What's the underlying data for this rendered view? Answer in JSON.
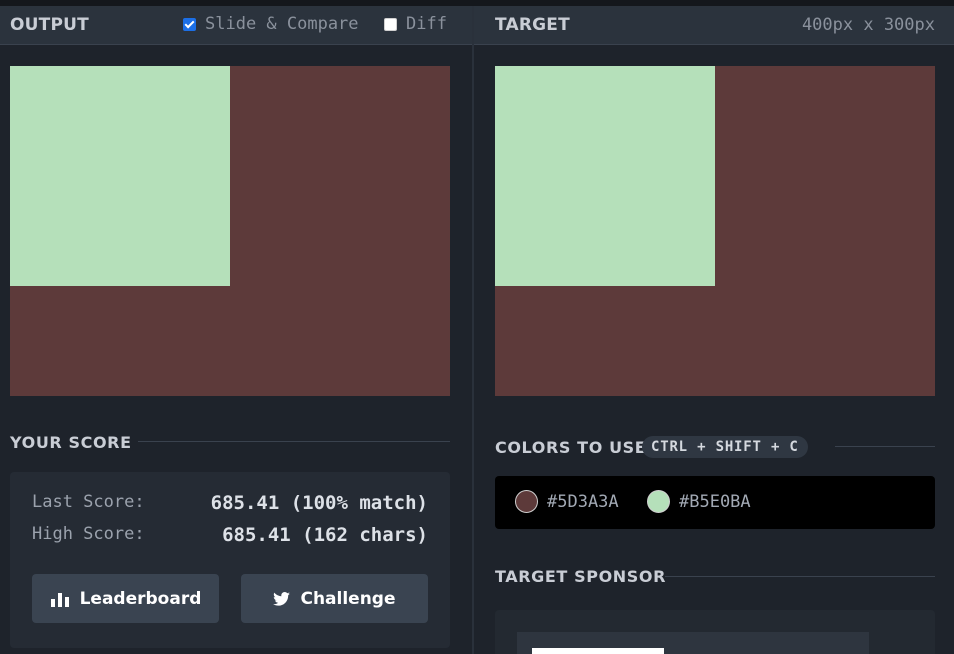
{
  "output_panel": {
    "title": "OUTPUT",
    "slide_compare": {
      "label": "Slide & Compare",
      "checked": true
    },
    "diff": {
      "label": "Diff",
      "checked": false
    }
  },
  "target_panel": {
    "title": "TARGET",
    "dimensions": "400px x 300px"
  },
  "canvas": {
    "background": "#5D3A3A",
    "square_color": "#B5E0BA"
  },
  "score": {
    "title": "YOUR SCORE",
    "last_label": "Last Score:",
    "last_value": "685.41 (100% match)",
    "high_label": "High Score:",
    "high_value": "685.41 (162 chars)",
    "leaderboard_label": "Leaderboard",
    "challenge_label": "Challenge"
  },
  "colors": {
    "title": "COLORS TO USE",
    "shortcut": "CTRL + SHIFT + C",
    "items": [
      {
        "hex": "#5D3A3A"
      },
      {
        "hex": "#B5E0BA"
      }
    ]
  },
  "sponsor": {
    "title": "TARGET SPONSOR"
  },
  "icons": {
    "leaderboard": "bar-chart-icon",
    "challenge": "twitter-icon"
  }
}
